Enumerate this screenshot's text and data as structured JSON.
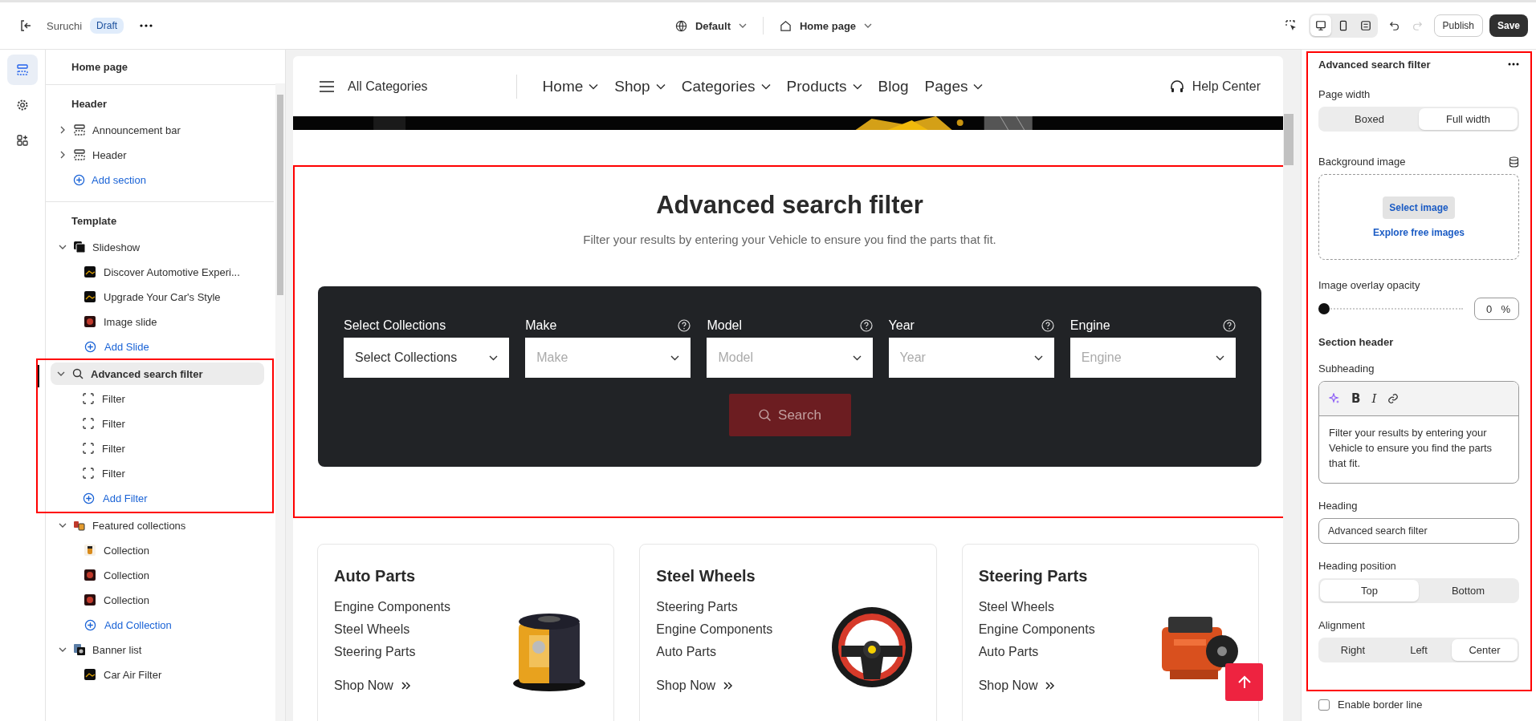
{
  "topbar": {
    "store_name": "Suruchi",
    "status": "Draft",
    "theme": "Default",
    "page": "Home page",
    "views": [
      {
        "kind": "desktop",
        "selected": true
      },
      {
        "kind": "mobile",
        "selected": false
      },
      {
        "kind": "fullscreen",
        "selected": false
      }
    ],
    "buttons": [
      {
        "label": "Publish",
        "kind": "secondary"
      },
      {
        "label": "Save",
        "kind": "primary"
      }
    ]
  },
  "rail": [
    {
      "kind": "sections",
      "selected": true
    },
    {
      "kind": "settings",
      "selected": false
    },
    {
      "kind": "apps",
      "selected": false
    }
  ],
  "sidebar": {
    "title": "Home page",
    "groups": [
      {
        "heading": "Header",
        "items": [
          {
            "label": "Announcement bar",
            "kind": "section",
            "expanded": false,
            "selected": false,
            "highlighted": false
          },
          {
            "label": "Header",
            "kind": "section",
            "expanded": false,
            "selected": false,
            "highlighted": false
          }
        ],
        "add": "Add section"
      },
      {
        "heading": "Template",
        "items": [
          {
            "label": "Slideshow",
            "kind": "slideshow",
            "expanded": true,
            "selected": false,
            "highlighted": false,
            "children": [
              {
                "label": "Discover Automotive Experi...",
                "kind": "dark"
              },
              {
                "label": "Upgrade Your Car's Style",
                "kind": "dark"
              },
              {
                "label": "Image slide",
                "kind": "red"
              }
            ],
            "add": "Add Slide"
          },
          {
            "label": "Advanced search filter",
            "kind": "search",
            "expanded": true,
            "selected": true,
            "highlighted": true,
            "children": [
              {
                "label": "Filter",
                "kind": "block"
              },
              {
                "label": "Filter",
                "kind": "block"
              },
              {
                "label": "Filter",
                "kind": "block"
              },
              {
                "label": "Filter",
                "kind": "block"
              }
            ],
            "add": "Add Filter"
          },
          {
            "label": "Featured collections",
            "kind": "collection",
            "expanded": true,
            "selected": false,
            "highlighted": false,
            "children": [
              {
                "label": "Collection",
                "kind": "orange"
              },
              {
                "label": "Collection",
                "kind": "red"
              },
              {
                "label": "Collection",
                "kind": "red"
              }
            ],
            "add": "Add Collection"
          },
          {
            "label": "Banner list",
            "kind": "banner",
            "expanded": true,
            "selected": false,
            "highlighted": false,
            "children": [
              {
                "label": "Car Air Filter",
                "kind": "dark"
              }
            ]
          }
        ]
      }
    ]
  },
  "preview": {
    "nav": {
      "menu": "All Categories",
      "links": [
        {
          "label": "Home",
          "dropdown": true
        },
        {
          "label": "Shop",
          "dropdown": true
        },
        {
          "label": "Categories",
          "dropdown": true
        },
        {
          "label": "Products",
          "dropdown": true
        },
        {
          "label": "Blog",
          "dropdown": false
        },
        {
          "label": "Pages",
          "dropdown": true
        }
      ],
      "help": "Help Center"
    },
    "search_section": {
      "highlighted": true,
      "heading": "Advanced search filter",
      "subheading": "Filter your results by entering your Vehicle to ensure you find the parts that fit.",
      "fields": [
        {
          "label": "Select Collections",
          "value": "Select Collections",
          "help": false
        },
        {
          "label": "Make",
          "placeholder": "Make",
          "help": true
        },
        {
          "label": "Model",
          "placeholder": "Model",
          "help": true
        },
        {
          "label": "Year",
          "placeholder": "Year",
          "help": true
        },
        {
          "label": "Engine",
          "placeholder": "Engine",
          "help": true
        }
      ],
      "button": {
        "label": "Search",
        "disabled": true
      }
    },
    "cards": [
      {
        "title": "Auto Parts",
        "links": [
          "Engine Components",
          "Steel Wheels",
          "Steering Parts"
        ],
        "cta": "Shop Now",
        "kind": "filter"
      },
      {
        "title": "Steel Wheels",
        "links": [
          "Steering Parts",
          "Engine Components",
          "Auto Parts"
        ],
        "cta": "Shop Now",
        "kind": "wheel"
      },
      {
        "title": "Steering Parts",
        "links": [
          "Steel Wheels",
          "Engine Components",
          "Auto Parts"
        ],
        "cta": "Shop Now",
        "kind": "engine"
      }
    ]
  },
  "settings": {
    "highlighted": true,
    "title": "Advanced search filter",
    "page_width": {
      "label": "Page width",
      "options": [
        {
          "label": "Boxed",
          "selected": false
        },
        {
          "label": "Full width",
          "selected": true
        }
      ]
    },
    "background_image": {
      "label": "Background image",
      "select": "Select image",
      "explore": "Explore free images"
    },
    "overlay": {
      "label": "Image overlay opacity",
      "level": 0,
      "value": "0",
      "unit": "%"
    },
    "section_header": "Section header",
    "subheading": {
      "label": "Subheading",
      "tools": [
        {
          "kind": "ai"
        },
        {
          "kind": "bold",
          "label": "B"
        },
        {
          "kind": "italic",
          "label": "I"
        },
        {
          "kind": "link"
        }
      ],
      "text": "Filter your results by entering your Vehicle to ensure you find the parts that fit."
    },
    "heading": {
      "label": "Heading",
      "value": "Advanced search filter"
    },
    "heading_position": {
      "label": "Heading position",
      "options": [
        {
          "label": "Top",
          "selected": true
        },
        {
          "label": "Bottom",
          "selected": false
        }
      ]
    },
    "alignment": {
      "label": "Alignment",
      "options": [
        {
          "label": "Right",
          "selected": false
        },
        {
          "label": "Left",
          "selected": false
        },
        {
          "label": "Center",
          "selected": true
        }
      ]
    },
    "border_line": {
      "label": "Enable border line",
      "checked": false
    }
  }
}
